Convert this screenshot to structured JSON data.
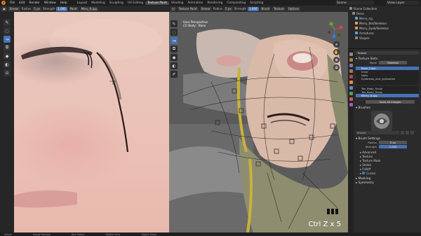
{
  "menubar": {
    "menus": [
      "File",
      "Edit",
      "Render",
      "Window",
      "Help"
    ],
    "workspaces": [
      "Layout",
      "Modeling",
      "Sculpting",
      "UV Editing",
      "Texture Paint",
      "Shading",
      "Animation",
      "Rendering",
      "Compositing",
      "Scripting"
    ],
    "active_workspace": "Texture Paint",
    "scene_name": "Scene",
    "view_layer": "View Layer"
  },
  "image_editor": {
    "header": {
      "brush": "Smear",
      "radius_label": "Radius",
      "radius_value": "5 px",
      "strength_label": "Strength",
      "strength_value": "1.000",
      "mode": "Paint",
      "image_name": "Mery_B.jpg"
    },
    "tools": [
      "brush-icon",
      "soften-icon",
      "smear-icon",
      "clone-icon",
      "fill-icon",
      "mask-icon",
      "sample-icon"
    ]
  },
  "viewport": {
    "header": {
      "mode": "Texture Paint",
      "brush": "Smear",
      "radius_label": "Radius",
      "radius_value": "5 px",
      "strength_label": "Strength",
      "strength_value": "1.000",
      "options": [
        "Brush",
        "Texture",
        "Options"
      ]
    },
    "info_line1": "User Perspective",
    "info_line2": "(1) Body : Bans",
    "undo_text": "Ctrl Z x 5"
  },
  "outliner": {
    "rows": [
      {
        "label": "Scene Collection",
        "indent": 0,
        "selected": false,
        "color": "#8a8a8a"
      },
      {
        "label": "Dena",
        "indent": 1,
        "selected": false,
        "color": "#8a8a8a"
      },
      {
        "label": "Merry_rig",
        "indent": 2,
        "selected": false,
        "color": "#58a8d8"
      },
      {
        "label": "Merry_Bot/Skeleton",
        "indent": 2,
        "selected": false,
        "color": "#e0a050"
      },
      {
        "label": "Merry_Eyeb/Skeleton",
        "indent": 2,
        "selected": false,
        "color": "#e0a050"
      },
      {
        "label": "Armatures",
        "indent": 2,
        "selected": false,
        "color": "#58a8d8"
      },
      {
        "label": "Shapes",
        "indent": 2,
        "selected": false,
        "color": "#8a8a8a"
      }
    ]
  },
  "properties": {
    "brush_name": "Smear",
    "texture_slots": {
      "title": "Texture Slots",
      "mode_label": "Mode",
      "mode_value": "Material",
      "slots": [
        "Base_Color",
        "Inner",
        "Nails",
        "Eyebrows_and_eyelashes"
      ]
    },
    "image_list": [
      "Tex_Body_Sculp",
      "Tex_Body_Sculp",
      "Merry_B.jpg"
    ],
    "save_button": "Save All Images",
    "brushes_title": "Brushes",
    "brush_settings": {
      "title": "Brush Settings",
      "radius_label": "Radius",
      "radius_value": "5 px",
      "strength_label": "Strength",
      "strength_value": "1.000",
      "subpanels": [
        "Advanced",
        "Texture",
        "Texture Mask",
        "Stroke",
        "Falloff",
        "Cursor"
      ]
    },
    "bottom_panels": [
      "Masking",
      "Symmetry"
    ]
  },
  "statusbar": {
    "items": [
      "Select",
      "Image Sample",
      "Box Select",
      "Rotate View",
      "Object Mode"
    ]
  }
}
